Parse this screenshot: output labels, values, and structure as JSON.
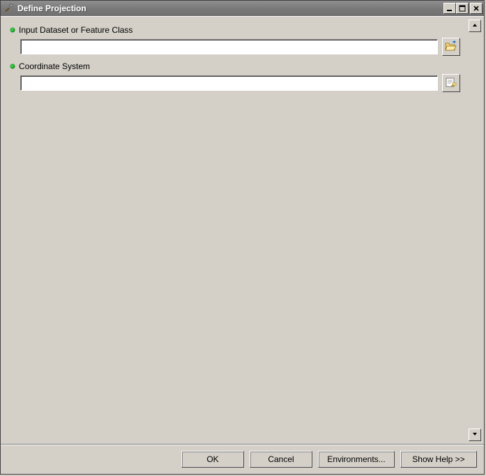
{
  "window": {
    "title": "Define Projection"
  },
  "params": {
    "input_dataset": {
      "label": "Input Dataset or Feature Class",
      "value": ""
    },
    "coord_system": {
      "label": "Coordinate System",
      "value": ""
    }
  },
  "buttons": {
    "ok": "OK",
    "cancel": "Cancel",
    "environments": "Environments...",
    "show_help": "Show Help >>"
  },
  "icons": {
    "app": "hammer-icon",
    "browse": "folder-open-icon",
    "properties": "properties-page-icon",
    "minimize": "minimize-icon",
    "maximize": "maximize-icon",
    "close": "close-icon",
    "scroll_up": "chevron-up-icon",
    "scroll_down": "chevron-down-icon"
  }
}
